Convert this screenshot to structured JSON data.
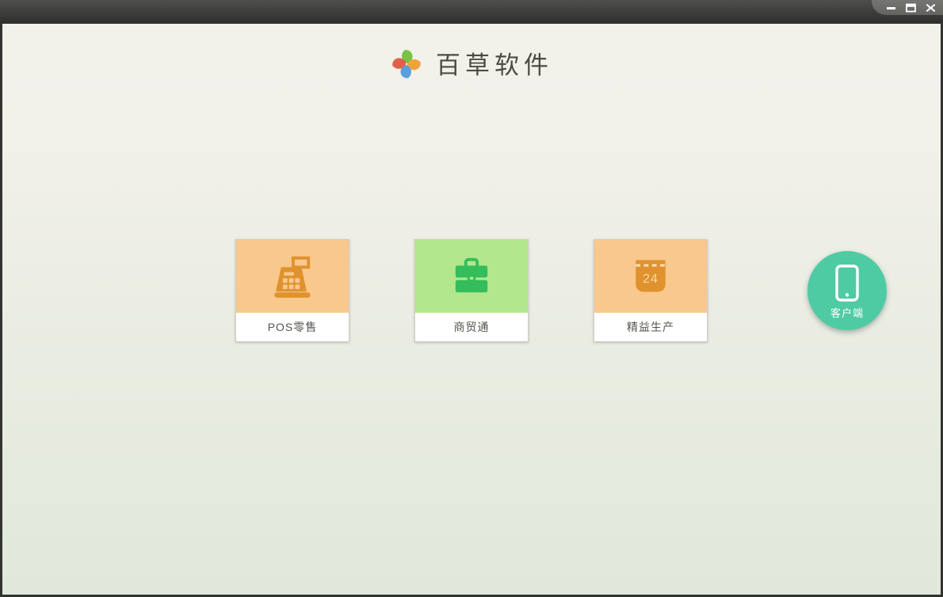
{
  "titlebar": {
    "controls": {
      "minimize": "minimize",
      "maximize": "maximize",
      "close": "close"
    }
  },
  "header": {
    "app_title": "百草软件",
    "logo": "pinwheel-logo",
    "logo_colors": {
      "top": "#76c43f",
      "right": "#f2a239",
      "bottom": "#5b9fdc",
      "left": "#e2604a"
    }
  },
  "products": [
    {
      "label": "POS零售",
      "icon": "cash-register-icon",
      "tile_color": "#f9c88d",
      "icon_color": "#e0922f"
    },
    {
      "label": "商贸通",
      "icon": "briefcase-icon",
      "tile_color": "#b3e78d",
      "icon_color": "#34bd5b"
    },
    {
      "label": "精益生产",
      "icon": "calendar-icon",
      "calendar_day": "24",
      "tile_color": "#f9c88d",
      "icon_color": "#e0922f"
    }
  ],
  "client": {
    "label": "客户端",
    "icon": "smartphone-icon",
    "color": "#4fcba4"
  }
}
